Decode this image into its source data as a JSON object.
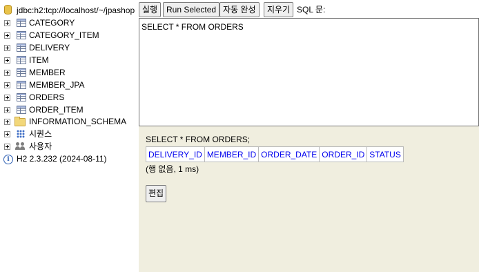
{
  "tree": {
    "connection": "jdbc:h2:tcp://localhost/~/jpashop",
    "tables": [
      "CATEGORY",
      "CATEGORY_ITEM",
      "DELIVERY",
      "ITEM",
      "MEMBER",
      "MEMBER_JPA",
      "ORDERS",
      "ORDER_ITEM"
    ],
    "schema": "INFORMATION_SCHEMA",
    "sequences": "시퀀스",
    "users": "사용자",
    "version": "H2 2.3.232 (2024-08-11)"
  },
  "toolbar": {
    "run": "실행",
    "run_selected": "Run Selected",
    "autocomplete": "자동 완성",
    "clear": "지우기",
    "sql_label": "SQL 문:"
  },
  "editor": {
    "sql": "SELECT * FROM ORDERS"
  },
  "result": {
    "sql": "SELECT * FROM ORDERS;",
    "columns": [
      "DELIVERY_ID",
      "MEMBER_ID",
      "ORDER_DATE",
      "ORDER_ID",
      "STATUS"
    ],
    "status": "(행 없음, 1 ms)",
    "edit": "편집"
  }
}
